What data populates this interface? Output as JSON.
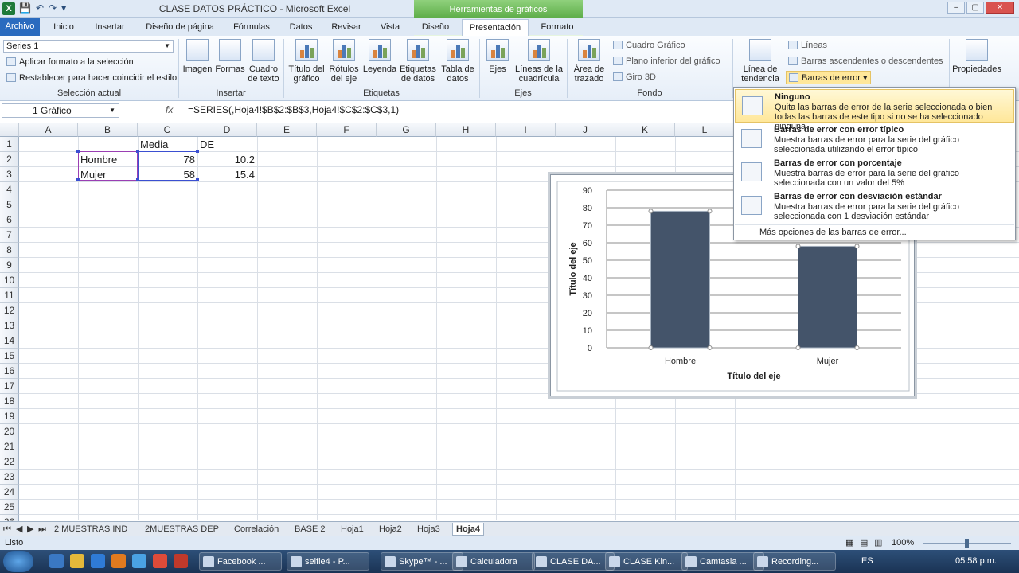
{
  "window": {
    "title": "CLASE DATOS PRÁCTICO  -  Microsoft Excel",
    "context_header": "Herramientas de gráficos",
    "min": "–",
    "max": "▢",
    "close": "✕"
  },
  "tabs": {
    "file": "Archivo",
    "inicio": "Inicio",
    "insertar": "Insertar",
    "diseno_pagina": "Diseño de página",
    "formulas": "Fórmulas",
    "datos": "Datos",
    "revisar": "Revisar",
    "vista": "Vista",
    "diseno": "Diseño",
    "presentacion": "Presentación",
    "formato": "Formato"
  },
  "ribbon": {
    "seleccion": {
      "series": "Series 1",
      "format_sel": "Aplicar formato a la selección",
      "reset_style": "Restablecer para hacer coincidir el estilo",
      "label": "Selección actual"
    },
    "insertar": {
      "imagen": "Imagen",
      "formas": "Formas",
      "cuadro1": "Cuadro",
      "cuadro2": "de texto",
      "label": "Insertar"
    },
    "etiquetas": {
      "titulo1": "Título del",
      "titulo2": "gráfico",
      "rotulos1": "Rótulos",
      "rotulos2": "del eje",
      "leyenda": "Leyenda",
      "etq1": "Etiquetas",
      "etq2": "de datos",
      "tabla1": "Tabla de",
      "tabla2": "datos",
      "label": "Etiquetas"
    },
    "ejes": {
      "ejes": "Ejes",
      "lineas1": "Líneas de la",
      "lineas2": "cuadrícula",
      "label": "Ejes"
    },
    "fondo": {
      "area1": "Área de",
      "area2": "trazado",
      "cuadro": "Cuadro Gráfico",
      "plano": "Plano inferior del gráfico",
      "giro": "Giro 3D",
      "label": "Fondo"
    },
    "analisis": {
      "tend1": "Línea de",
      "tend2": "tendencia",
      "lineas": "Líneas",
      "barras_asc": "Barras ascendentes o descendentes",
      "barras_err": "Barras de error"
    },
    "propiedades": "Propiedades"
  },
  "formula_bar": {
    "name_box": "1 Gráfico",
    "fx": "fx",
    "formula": "=SERIES(,Hoja4!$B$2:$B$3,Hoja4!$C$2:$C$3,1)"
  },
  "columns": [
    "A",
    "B",
    "C",
    "D",
    "E",
    "F",
    "G",
    "H",
    "I",
    "J",
    "K",
    "L"
  ],
  "rows": [
    "1",
    "2",
    "3",
    "4",
    "5",
    "6",
    "7",
    "8",
    "9",
    "10",
    "11",
    "12",
    "13",
    "14",
    "15",
    "16",
    "17",
    "18",
    "19",
    "20",
    "21",
    "22",
    "23",
    "24",
    "25",
    "26"
  ],
  "cells": {
    "c1": "Media",
    "d1": "DE",
    "b2": "Hombre",
    "c2": "78",
    "d2": "10.2",
    "b3": "Mujer",
    "c3": "58",
    "d3": "15.4"
  },
  "chart_data": {
    "type": "bar",
    "categories": [
      "Hombre",
      "Mujer"
    ],
    "values": [
      78,
      58
    ],
    "ylim": [
      0,
      90
    ],
    "yticks": [
      "0",
      "10",
      "20",
      "30",
      "40",
      "50",
      "60",
      "70",
      "80",
      "90"
    ],
    "xlabel": "Título del eje",
    "ylabel": "Título del eje",
    "grid": true,
    "bar_color": "#44546a"
  },
  "error_bars_menu": {
    "items": [
      {
        "title": "Ninguno",
        "desc": "Quita las barras de error de la serie seleccionada o bien todas las barras de este tipo si no se ha seleccionado ninguna"
      },
      {
        "title": "Barras de error con error típico",
        "desc": "Muestra barras de error para la serie del gráfico seleccionada utilizando el error típico"
      },
      {
        "title": "Barras de error con porcentaje",
        "desc": "Muestra barras de error para la serie del gráfico seleccionada con un valor del 5%"
      },
      {
        "title": "Barras de error con desviación estándar",
        "desc": "Muestra barras de error para la serie del gráfico seleccionada con 1 desviación estándar"
      }
    ],
    "more": "Más opciones de las barras de error..."
  },
  "sheet_tabs": [
    "2 MUESTRAS IND",
    "2MUESTRAS DEP",
    "Correlación",
    "BASE 2",
    "Hoja1",
    "Hoja2",
    "Hoja3",
    "Hoja4"
  ],
  "status": {
    "ready": "Listo",
    "zoom": "100%"
  },
  "taskbar": {
    "items": [
      "Facebook ...",
      "selfie4 - P...",
      "Skype™ - ...",
      "Calculadora",
      "CLASE DA...",
      "CLASE Kin...",
      "Camtasia ...",
      "Recording..."
    ],
    "lang": "ES",
    "time": "05:58 p.m."
  }
}
